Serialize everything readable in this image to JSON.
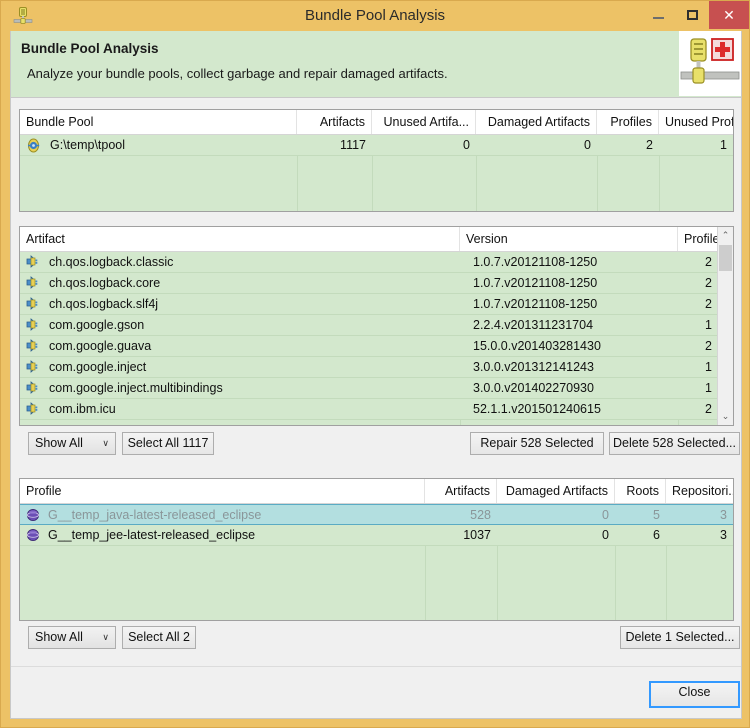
{
  "window": {
    "title": "Bundle Pool Analysis",
    "icon": "bundle-pool-icon",
    "minimize_label": "–",
    "maximize_label": "□",
    "close_label": "✕"
  },
  "banner": {
    "title": "Bundle Pool Analysis",
    "subtitle": "Analyze your bundle pools, collect garbage and repair damaged artifacts.",
    "icon": "bundle-pool-repair-icon"
  },
  "pool_table": {
    "columns": [
      "Bundle Pool",
      "Artifacts",
      "Unused Artifa...",
      "Damaged Artifacts",
      "Profiles",
      "Unused Profi..."
    ],
    "rows": [
      {
        "icon": "bundle-pool-disk-icon",
        "name": "G:\\temp\\tpool",
        "artifacts": "1117",
        "unused_artifacts": "0",
        "damaged_artifacts": "0",
        "profiles": "2",
        "unused_profiles": "1"
      }
    ]
  },
  "artifact_table": {
    "columns": [
      "Artifact",
      "Version",
      "Profiles"
    ],
    "rows": [
      {
        "icon": "artifact-bundle-icon",
        "name": "ch.qos.logback.classic",
        "version": "1.0.7.v20121108-1250",
        "profiles": "2"
      },
      {
        "icon": "artifact-bundle-icon",
        "name": "ch.qos.logback.core",
        "version": "1.0.7.v20121108-1250",
        "profiles": "2"
      },
      {
        "icon": "artifact-bundle-icon",
        "name": "ch.qos.logback.slf4j",
        "version": "1.0.7.v20121108-1250",
        "profiles": "2"
      },
      {
        "icon": "artifact-bundle-icon",
        "name": "com.google.gson",
        "version": "2.2.4.v201311231704",
        "profiles": "1"
      },
      {
        "icon": "artifact-bundle-icon",
        "name": "com.google.guava",
        "version": "15.0.0.v201403281430",
        "profiles": "2"
      },
      {
        "icon": "artifact-bundle-icon",
        "name": "com.google.inject",
        "version": "3.0.0.v201312141243",
        "profiles": "1"
      },
      {
        "icon": "artifact-bundle-icon",
        "name": "com.google.inject.multibindings",
        "version": "3.0.0.v201402270930",
        "profiles": "1"
      },
      {
        "icon": "artifact-bundle-icon",
        "name": "com.ibm.icu",
        "version": "52.1.1.v201501240615",
        "profiles": "2"
      }
    ],
    "scrollbar": {
      "up_glyph": "⌃",
      "down_glyph": "⌄"
    }
  },
  "artifact_toolbar": {
    "filter_value": "Show All",
    "filter_arrow": "∨",
    "select_all_label": "Select All 1117",
    "repair_label": "Repair 528 Selected",
    "delete_label": "Delete 528 Selected..."
  },
  "profile_table": {
    "columns": [
      "Profile",
      "Artifacts",
      "Damaged Artifacts",
      "Roots",
      "Repositori..."
    ],
    "rows": [
      {
        "icon": "profile-sphere-icon",
        "name": "G__temp_java-latest-released_eclipse",
        "artifacts": "528",
        "damaged_artifacts": "0",
        "roots": "5",
        "repositories": "3",
        "selected": true
      },
      {
        "icon": "profile-sphere-icon",
        "name": "G__temp_jee-latest-released_eclipse",
        "artifacts": "1037",
        "damaged_artifacts": "0",
        "roots": "6",
        "repositories": "3",
        "selected": false
      }
    ]
  },
  "profile_toolbar": {
    "filter_value": "Show All",
    "filter_arrow": "∨",
    "select_all_label": "Select All 2",
    "delete_label": "Delete 1 Selected..."
  },
  "footer": {
    "close_label": "Close"
  },
  "colors": {
    "window_chrome": "#edc266",
    "banner_bg": "#d3e8cd",
    "row_bg": "#d3e8cd",
    "row_selected_bg": "#b3dfe0",
    "close_button": "#c75050",
    "focus_border": "#3399ff"
  }
}
